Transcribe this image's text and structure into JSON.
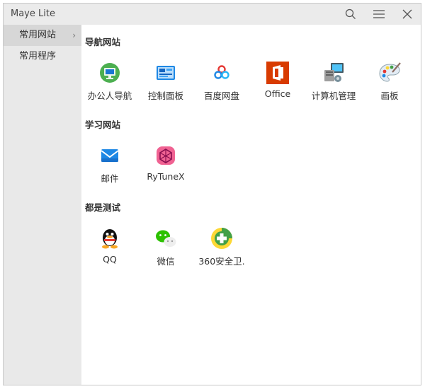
{
  "app": {
    "title": "Maye Lite"
  },
  "titlebar": {
    "search_icon": "search-icon",
    "menu_icon": "menu-icon",
    "close_icon": "close-icon"
  },
  "sidebar": {
    "items": [
      {
        "label": "常用网站",
        "active": true
      },
      {
        "label": "常用程序",
        "active": false
      }
    ]
  },
  "sections": [
    {
      "title": "导航网站",
      "items": [
        {
          "label": "办公人导航",
          "icon": "office-nav-icon"
        },
        {
          "label": "控制面板",
          "icon": "control-panel-icon"
        },
        {
          "label": "百度网盘",
          "icon": "baidu-netdisk-icon"
        },
        {
          "label": "Office",
          "icon": "office-icon"
        },
        {
          "label": "计算机管理",
          "icon": "computer-management-icon"
        },
        {
          "label": "画板",
          "icon": "paint-icon"
        }
      ]
    },
    {
      "title": "学习网站",
      "items": [
        {
          "label": "邮件",
          "icon": "mail-icon"
        },
        {
          "label": "RyTuneX",
          "icon": "rytunex-icon"
        }
      ]
    },
    {
      "title": "都是测试",
      "items": [
        {
          "label": "QQ",
          "icon": "qq-icon"
        },
        {
          "label": "微信",
          "icon": "wechat-icon"
        },
        {
          "label": "360安全卫.",
          "icon": "360-security-icon"
        }
      ]
    }
  ]
}
